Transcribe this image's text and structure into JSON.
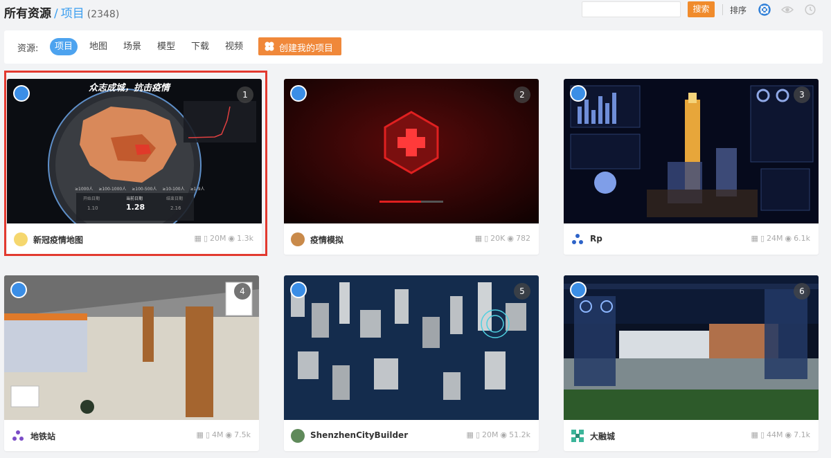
{
  "header": {
    "title": "所有资源",
    "separator": "/",
    "section": "项目",
    "count": "(2348)",
    "search_placeholder": "",
    "search_button": "搜索",
    "sort_label": "排序",
    "icons": [
      "lifebuoy-icon",
      "eye-icon",
      "clock-icon"
    ]
  },
  "filter": {
    "label": "资源:",
    "chips": [
      "项目",
      "地图",
      "场景",
      "模型",
      "下载",
      "视频"
    ],
    "active": "项目",
    "create_button": "创建我的项目"
  },
  "colors": {
    "accent": "#4da3ef",
    "orange": "#f08b2c",
    "highlight": "#e2392f"
  },
  "cards": [
    {
      "number": "1",
      "title": "新冠疫情地图",
      "size": "20M",
      "views": "1.3k",
      "thumb": {
        "headline": "众志成城，抗击疫情",
        "legend": [
          "≥1000人",
          "≥100-1000人",
          "≥100-500人",
          "≥10-100人",
          "≥1-9人"
        ],
        "stats": {
          "col1": "开始日期",
          "col2": "当前日期",
          "col3": "结束日期",
          "v1": "1.10",
          "v2": "1.28",
          "v3": "2.16"
        }
      }
    },
    {
      "number": "2",
      "title": "疫情模拟",
      "size": "20K",
      "views": "782"
    },
    {
      "number": "3",
      "title": "Rp",
      "size": "24M",
      "views": "6.1k"
    },
    {
      "number": "4",
      "title": "地铁站",
      "size": "4M",
      "views": "7.5k"
    },
    {
      "number": "5",
      "title": "ShenzhenCityBuilder",
      "size": "20M",
      "views": "51.2k"
    },
    {
      "number": "6",
      "title": "大融城",
      "size": "44M",
      "views": "7.1k"
    }
  ]
}
